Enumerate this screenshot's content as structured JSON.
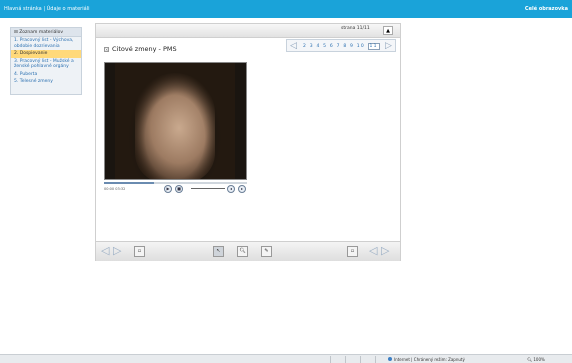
{
  "topbar": {
    "home": "Hlavná stránka",
    "separator": "|",
    "material_info": "Údaje o materiáli",
    "fullscreen": "Celé obrazovka"
  },
  "sidebar": {
    "title": "Zoznam materiálov",
    "items": [
      {
        "label": "1. Pracovný list - Výchova, obdobie dozrievania"
      },
      {
        "label": "2. Dospievanie"
      },
      {
        "label": "3. Pracovný list - Mužské a ženské pohlavné orgány"
      },
      {
        "label": "4. Puberta"
      },
      {
        "label": "5. Telesné zmeny"
      }
    ]
  },
  "viewer": {
    "page_label": "strana 11/11",
    "up_icon": "arrow-up-icon",
    "pager_numbers": [
      "2",
      "3",
      "4",
      "5",
      "6",
      "7",
      "8",
      "9",
      "10",
      "11"
    ],
    "current_page": "11",
    "title": "Citové zmeny - PMS",
    "video": {
      "time_current": "00:00",
      "time_total": "03:32",
      "progress": 0.35
    }
  },
  "statusbar": {
    "zone": "Internet | Chránený režim: Zapnutý",
    "zoom": "100%"
  },
  "colors": {
    "topbar": "#1aa3d9",
    "active_item": "#ffd97a",
    "link": "#2a6fb0"
  }
}
